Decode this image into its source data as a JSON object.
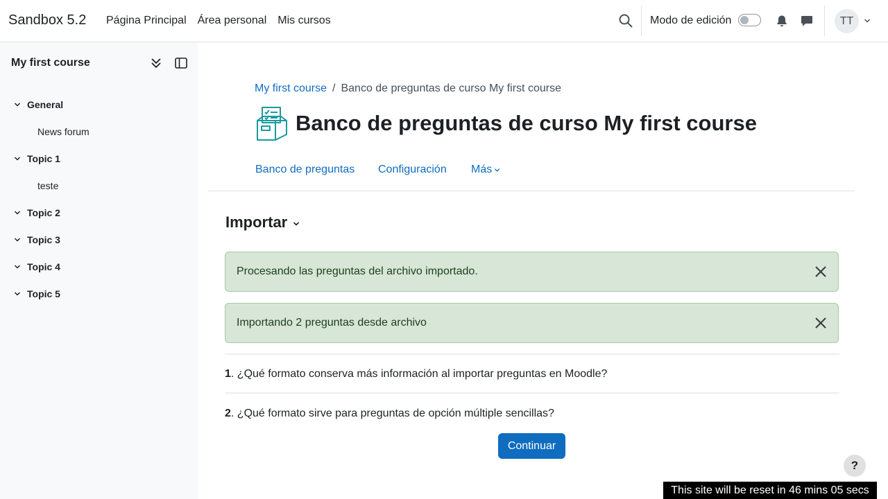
{
  "navbar": {
    "brand": "Sandbox 5.2",
    "links": [
      "Página Principal",
      "Área personal",
      "Mis cursos"
    ],
    "edit_mode_label": "Modo de edición",
    "avatar_initials": "TT"
  },
  "drawer": {
    "title": "My first course",
    "sections": [
      {
        "label": "General",
        "activities": [
          "News forum"
        ]
      },
      {
        "label": "Topic 1",
        "activities": [
          "teste"
        ]
      },
      {
        "label": "Topic 2",
        "activities": []
      },
      {
        "label": "Topic 3",
        "activities": []
      },
      {
        "label": "Topic 4",
        "activities": []
      },
      {
        "label": "Topic 5",
        "activities": []
      }
    ]
  },
  "breadcrumb": {
    "course": "My first course",
    "separator": "/",
    "current": "Banco de preguntas de curso My first course"
  },
  "page": {
    "title": "Banco de preguntas de curso My first course",
    "tabs": [
      "Banco de preguntas",
      "Configuración",
      "Más"
    ]
  },
  "import": {
    "heading": "Importar",
    "alerts": [
      "Procesando las preguntas del archivo importado.",
      "Importando 2 preguntas desde archivo"
    ],
    "questions": [
      {
        "num": "1",
        "text": ". ¿Qué formato conserva más información al importar preguntas en Moodle?"
      },
      {
        "num": "2",
        "text": ". ¿Qué formato sirve para preguntas de opción múltiple sencillas?"
      }
    ],
    "continue_label": "Continuar"
  },
  "footer": {
    "help": "?",
    "reset_text": "This site will be reset in 46 mins 05 secs"
  },
  "colors": {
    "link": "#0f6cbf",
    "alert_bg": "#d7e6d7",
    "alert_border": "#a4cba4",
    "primary_button": "#0f6cbf",
    "drawer_bg": "#f8f9fa",
    "icon_teal": "#1a9aa0"
  },
  "icons": {
    "search": "search-icon",
    "bell": "bell-icon",
    "chat": "chat-icon",
    "collapse_all": "double-chevron-down-icon",
    "close_drawer": "sidebar-panel-icon",
    "alert_close": "close-icon",
    "page_icon": "question-bank-icon"
  }
}
